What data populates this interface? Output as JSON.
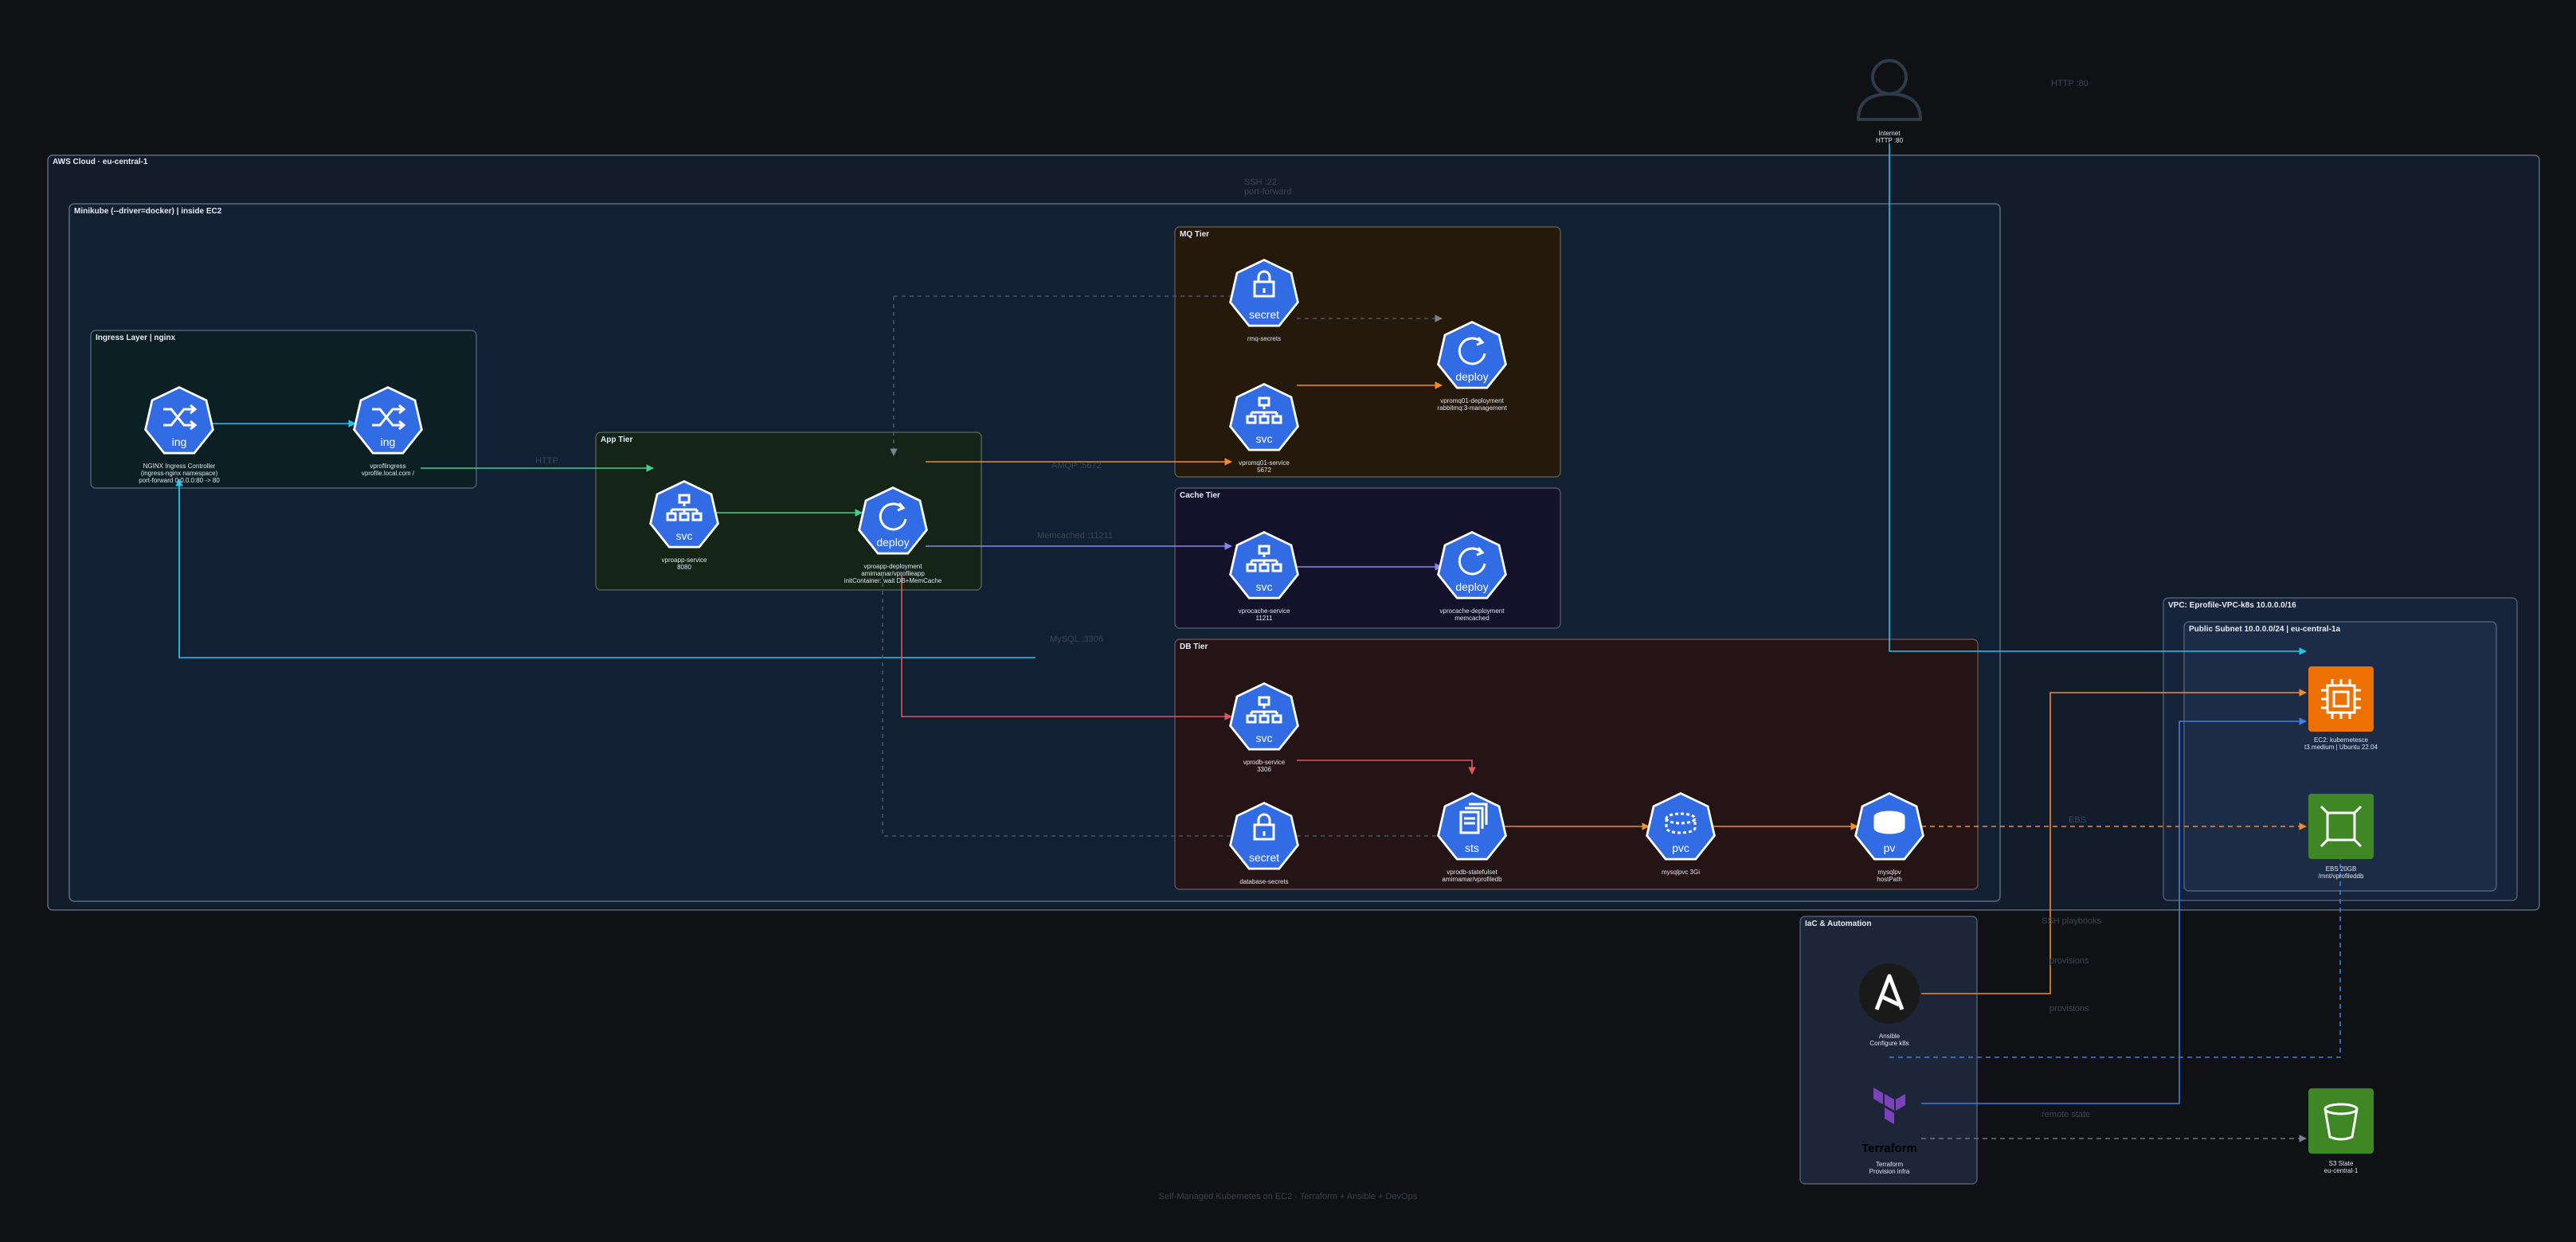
{
  "footer": "Self-Managed Kubernetes on EC2 · Terraform + Ansible + DevOps",
  "user": {
    "label1": "Internet",
    "label2": "HTTP :80"
  },
  "containers": {
    "aws": "AWS Cloud · eu-central-1",
    "minikube": "Minikube (--driver=docker) | inside EC2",
    "ingress_layer": "Ingress Layer | nginx",
    "app_tier": "App Tier",
    "mq_tier": "MQ Tier",
    "cache_tier": "Cache Tier",
    "db_tier": "DB Tier",
    "vpc": "VPC: Eprofile-VPC-k8s 10.0.0.0/16",
    "public_subnet": "Public Subnet 10.0.0.0/24 | eu-central-1a",
    "iac": "IaC & Automation"
  },
  "nodes": {
    "ingress_controller": {
      "icon": "ing",
      "line1": "NGINX Ingress Controller",
      "line2": "(ingress-nginx namespace)",
      "line3": "port-forward 0.0.0.0:80 -> 80"
    },
    "vpro_ingress": {
      "icon": "ing",
      "line1": "vproflingress",
      "line2": "vprofile.local.com /"
    },
    "app_service": {
      "icon": "svc",
      "line1": "vproapp-service",
      "line2": "8080"
    },
    "app_deploy": {
      "icon": "deploy",
      "line1": "vproapp-deployment",
      "line2": "amirnamar/vprofileapp",
      "line3": "initContainer: wait DB+MemCache"
    },
    "mq_secret": {
      "icon": "secret",
      "line1": "rmq-secrets"
    },
    "mq_service": {
      "icon": "svc",
      "line1": "vpromq01-service",
      "line2": "5672"
    },
    "mq_deploy": {
      "icon": "deploy",
      "line1": "vpromq01-deployment",
      "line2": "rabbitmq:3-management"
    },
    "cache_service": {
      "icon": "svc",
      "line1": "vprocache-service",
      "line2": "11211"
    },
    "cache_deploy": {
      "icon": "deploy",
      "line1": "vprocache-deployment",
      "line2": "memcached"
    },
    "db_service": {
      "icon": "svc",
      "line1": "vprodb-service",
      "line2": "3306"
    },
    "db_secret": {
      "icon": "secret",
      "line1": "database-secrets"
    },
    "db_sts": {
      "icon": "sts",
      "line1": "vprodb-statefulset",
      "line2": "amirnamar/vprofiledb"
    },
    "db_pvc": {
      "icon": "pvc",
      "line1": "mysqlpvc 3Gi"
    },
    "db_pv": {
      "icon": "pv",
      "line1": "mysqlpv",
      "line2": "hostPath"
    },
    "ec2": {
      "line1": "EC2: kubernetesce",
      "line2": "t3.medium | Ubuntu 22.04"
    },
    "ebs": {
      "line1": "EBS 20GB",
      "line2": "/mnt/vprofileddb"
    },
    "ansible": {
      "line1": "Ansible",
      "line2": "Configure k8s"
    },
    "terraform": {
      "wordmark": "Terraform",
      "line1": "Terraform",
      "line2": "Provision infra"
    },
    "s3": {
      "line1": "S3 State",
      "line2": "eu-central-1"
    }
  },
  "edge_labels": {
    "internet": "HTTP :80",
    "vpc_top1": "SSH :22",
    "vpc_top2": "port-forward",
    "mq_edge": "AMQP :5672",
    "cache_edge": "Memcached :11211",
    "db_edge": "MySQL :3306",
    "ebs_edge": "EBS",
    "ssh_playbooks": "SSH playbooks",
    "provision1": "provisions",
    "provision2": "provisions",
    "remote_state": "remote state",
    "ingress_edge": "HTTP"
  },
  "colors": {
    "svc_blue": "#326ce5",
    "cyan": "#22c4ee",
    "green": "#3ed38a",
    "orange": "#f08c2a",
    "purple": "#8a86ee",
    "red": "#e0555f",
    "ec2_orange": "#ed7100",
    "ebs_green": "#3f8624"
  }
}
